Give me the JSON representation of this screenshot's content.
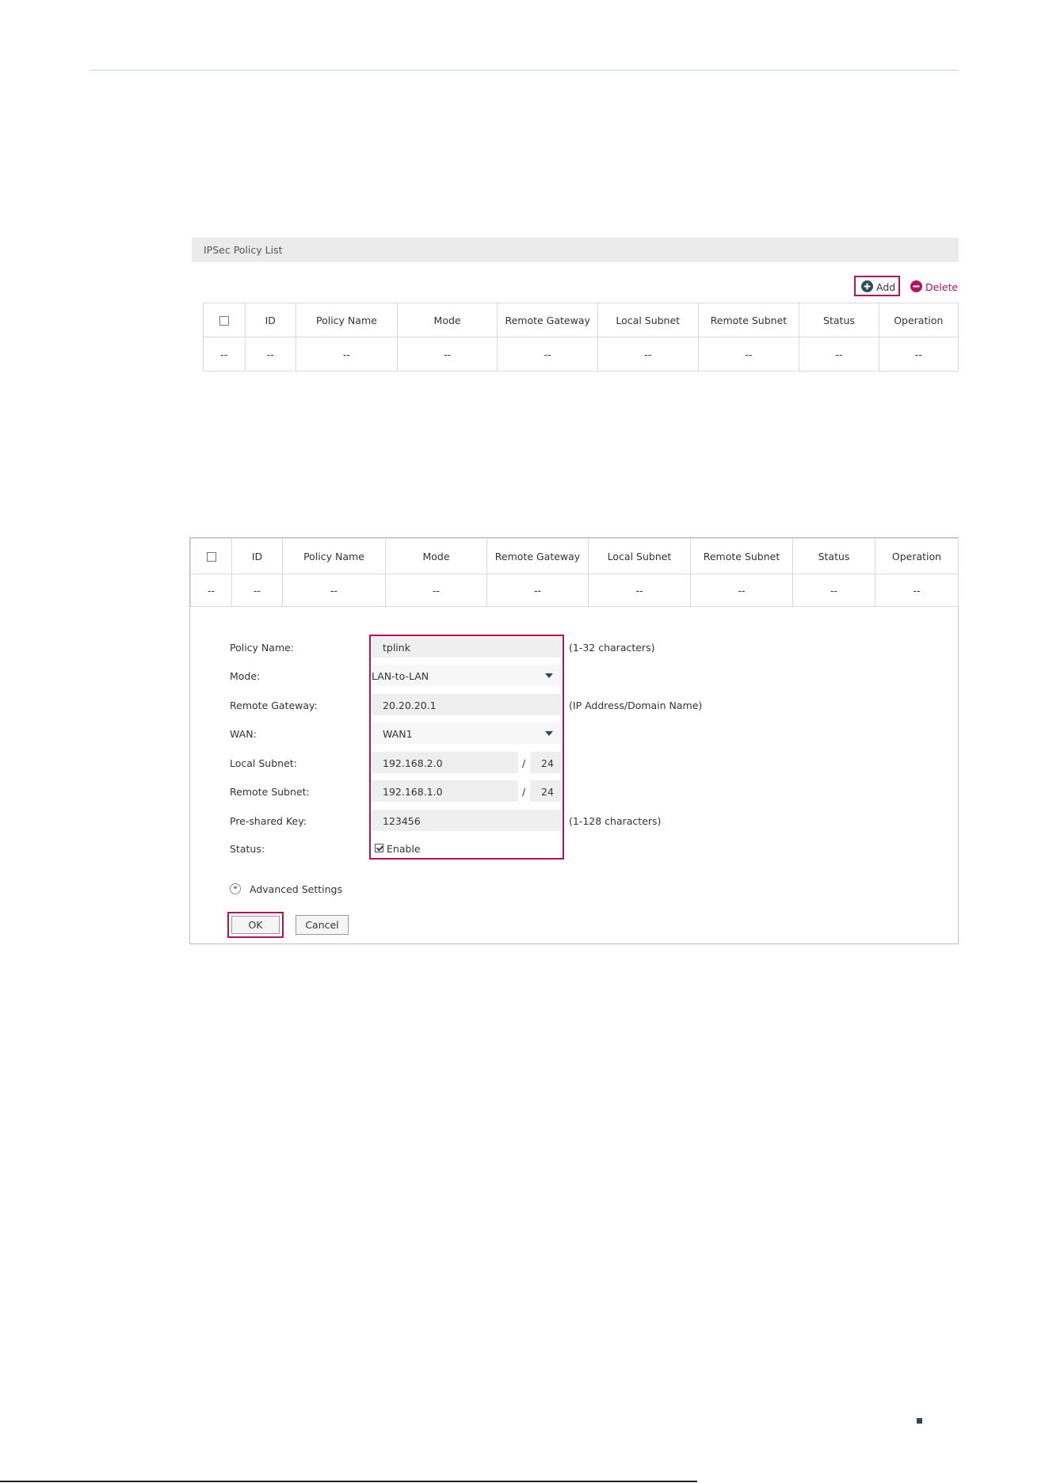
{
  "policy_list": {
    "title": "IPSec Policy List",
    "add_label": "Add",
    "delete_label": "Delete",
    "columns": [
      "ID",
      "Policy Name",
      "Mode",
      "Remote Gateway",
      "Local Subnet",
      "Remote Subnet",
      "Status",
      "Operation"
    ],
    "empty_row": [
      "--",
      "--",
      "--",
      "--",
      "--",
      "--",
      "--",
      "--",
      "--"
    ]
  },
  "form": {
    "policy_name_label": "Policy Name:",
    "policy_name_value": "tplink",
    "policy_name_hint": "(1-32 characters)",
    "mode_label": "Mode:",
    "mode_value": "LAN-to-LAN",
    "remote_gateway_label": "Remote Gateway:",
    "remote_gateway_value": "20.20.20.1",
    "remote_gateway_hint": "(IP Address/Domain Name)",
    "wan_label": "WAN:",
    "wan_value": "WAN1",
    "local_subnet_label": "Local Subnet:",
    "local_subnet_ip": "192.168.2.0",
    "local_subnet_mask": "24",
    "remote_subnet_label": "Remote Subnet:",
    "remote_subnet_ip": "192.168.1.0",
    "remote_subnet_mask": "24",
    "slash": "/",
    "psk_label": "Pre-shared Key:",
    "psk_value": "123456",
    "psk_hint": "(1-128 characters)",
    "status_label": "Status:",
    "status_enable_label": "Enable",
    "advanced_label": "Advanced Settings",
    "ok_label": "OK",
    "cancel_label": "Cancel"
  },
  "colors": {
    "highlight": "#b1135f",
    "accent": "#2f4a57"
  }
}
